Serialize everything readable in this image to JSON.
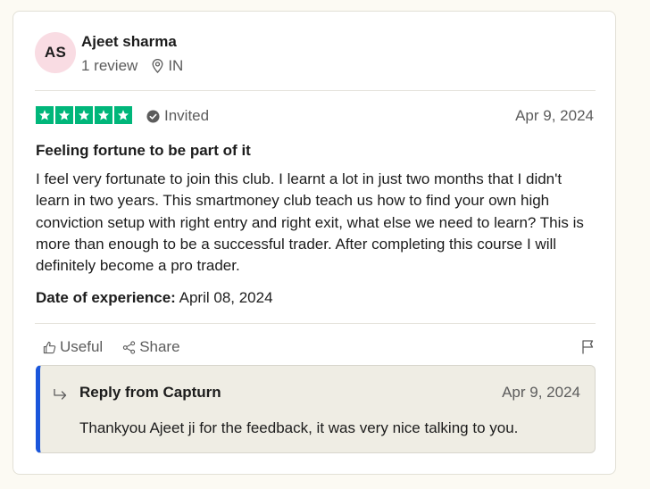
{
  "reviewer": {
    "initials": "AS",
    "name": "Ajeet sharma",
    "review_count": "1 review",
    "location": "IN"
  },
  "review": {
    "rating": 5,
    "star_color": "#00b67a",
    "invited_label": "Invited",
    "date": "Apr 9, 2024",
    "title": "Feeling fortune to be part of it",
    "body": "I feel very fortunate to join this club. I learnt a lot in just two months that I didn't learn in two years. This smartmoney club teach us how to find your own high conviction setup with right entry and right exit, what else we need to learn? This is more than enough to be a successful trader. After completing this course I will definitely become a pro trader.",
    "experience_label": "Date of experience:",
    "experience_date": "April 08, 2024"
  },
  "actions": {
    "useful_label": "Useful",
    "share_label": "Share"
  },
  "reply": {
    "title": "Reply from Capturn",
    "date": "Apr 9, 2024",
    "body": "Thankyou Ajeet ji for the feedback, it was very nice talking to you.",
    "accent_color": "#1a56db"
  },
  "icons": {
    "star": "star-icon",
    "invited": "check-circle-icon",
    "location": "location-pin-icon",
    "useful": "thumbs-up-icon",
    "share": "share-icon",
    "flag": "flag-icon",
    "reply": "reply-arrow-icon"
  }
}
